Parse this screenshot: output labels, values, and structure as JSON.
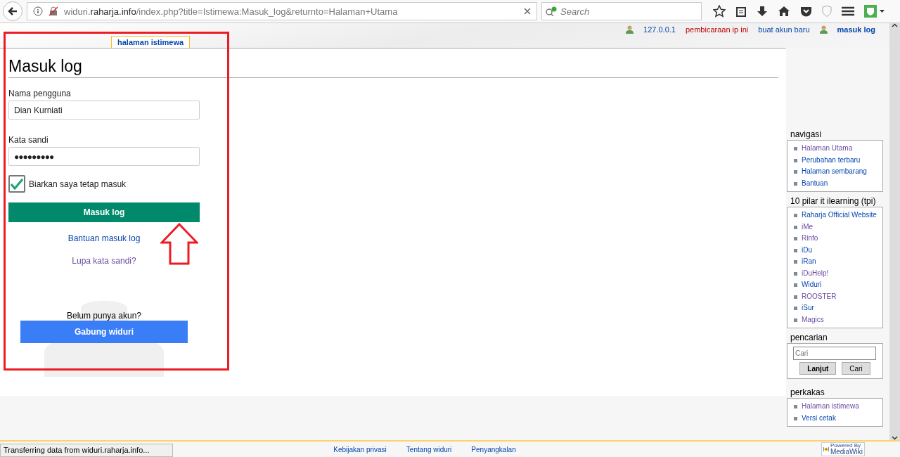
{
  "browser": {
    "url": "widuri.**raharja.info**/index.php?title=Istimewa:Masuk_log&returnto=Halaman+Utama",
    "search_placeholder": "Search",
    "status": "Transferring data from widuri.raharja.info..."
  },
  "personal_links": [
    {
      "kind": "user",
      "label": "127.0.0.1"
    },
    {
      "kind": "talk",
      "label": "pembicaraan ip ini"
    },
    {
      "kind": "link",
      "label": "buat akun baru"
    },
    {
      "kind": "user",
      "label": "masuk log"
    }
  ],
  "tab": {
    "label": "halaman istimewa",
    "selected": true
  },
  "heading": "Masuk log",
  "form": {
    "username_label": "Nama pengguna",
    "username": "Dian Kurniati",
    "password_label": "Kata sandi",
    "password": "●●●●●●●●●",
    "remember": {
      "label": "Biarkan saya tetap masuk",
      "checked": true
    },
    "submit": "Masuk log",
    "help_link": "Bantuan masuk log",
    "forgot_link": "Lupa kata sandi?",
    "signup_prompt": "Belum punya akun?",
    "signup_button": "Gabung widuri"
  },
  "sidebar": [
    {
      "title": "navigasi",
      "items": [
        {
          "label": "Halaman Utama",
          "visited": true
        },
        {
          "label": "Perubahan terbaru",
          "visited": false
        },
        {
          "label": "Halaman sembarang",
          "visited": false
        },
        {
          "label": "Bantuan",
          "visited": false
        }
      ]
    },
    {
      "title": "10 pilar it ilearning (tpi)",
      "items": [
        {
          "label": "Raharja Official Website",
          "visited": false
        },
        {
          "label": "iMe",
          "visited": true
        },
        {
          "label": "Rinfo",
          "visited": true
        },
        {
          "label": "iDu",
          "visited": false
        },
        {
          "label": "iRan",
          "visited": false
        },
        {
          "label": "iDuHelp!",
          "visited": true
        },
        {
          "label": "Widuri",
          "visited": false
        },
        {
          "label": "ROOSTER",
          "visited": true
        },
        {
          "label": "iSur",
          "visited": false
        },
        {
          "label": "Magics",
          "visited": true
        }
      ]
    },
    {
      "title": "pencarian",
      "search": {
        "placeholder": "Cari",
        "buttons": [
          "Lanjut",
          "Cari"
        ]
      }
    },
    {
      "title": "perkakas",
      "items": [
        {
          "label": "Halaman istimewa",
          "visited": true
        },
        {
          "label": "Versi cetak",
          "visited": false
        }
      ]
    }
  ],
  "footer_links": [
    "Kebijakan privasi",
    "Tentang widuri",
    "Penyangkalan"
  ],
  "badge": {
    "line1": "Powered By",
    "line2": "MediaWiki"
  }
}
